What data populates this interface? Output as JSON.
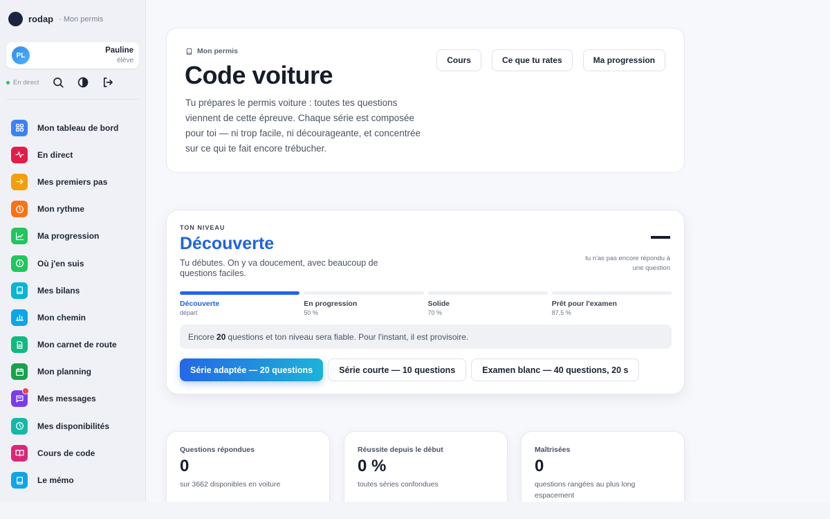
{
  "brand": {
    "name": "rodap",
    "subtitle": "· Mon permis"
  },
  "user": {
    "initials": "PL",
    "name": "Pauline",
    "role": "élève"
  },
  "tools": {
    "live_label": "En direct"
  },
  "nav": [
    {
      "label": "Mon tableau de bord",
      "icon": "dashboard-icon",
      "color": "#3b82f6"
    },
    {
      "label": "En direct",
      "icon": "activity-icon",
      "color": "#e11d48"
    },
    {
      "label": "Mes premiers pas",
      "icon": "arrow-right-icon",
      "color": "#f59e0b"
    },
    {
      "label": "Mon rythme",
      "icon": "clock-icon",
      "color": "#f97316"
    },
    {
      "label": "Ma progression",
      "icon": "chart-icon",
      "color": "#22c55e"
    },
    {
      "label": "Où j'en suis",
      "icon": "info-icon",
      "color": "#22c55e"
    },
    {
      "label": "Mes bilans",
      "icon": "book-icon",
      "color": "#06b6d4"
    },
    {
      "label": "Mon chemin",
      "icon": "bar-chart-icon",
      "color": "#0ea5e9"
    },
    {
      "label": "Mon carnet de route",
      "icon": "document-icon",
      "color": "#10b981"
    },
    {
      "label": "Mon planning",
      "icon": "calendar-icon",
      "color": "#16a34a"
    },
    {
      "label": "Mes messages",
      "icon": "message-icon",
      "color": "#7c3aed",
      "badge": true
    },
    {
      "label": "Mes disponibilités",
      "icon": "clock-icon",
      "color": "#14b8a6"
    },
    {
      "label": "Cours de code",
      "icon": "open-book-icon",
      "color": "#db2777"
    },
    {
      "label": "Le mémo",
      "icon": "book-icon",
      "color": "#0ea5e9"
    }
  ],
  "hero": {
    "eyebrow": "Mon permis",
    "title": "Code voiture",
    "description": "Tu prépares le permis voiture : toutes tes questions viennent de cette épreuve. Chaque série est composée pour toi — ni trop facile, ni décourageante, et concentrée sur ce qui te fait encore trébucher.",
    "actions": [
      "Cours",
      "Ce que tu rates",
      "Ma progression"
    ]
  },
  "level": {
    "eyebrow": "TON NIVEAU",
    "title": "Découverte",
    "description": "Tu débutes. On y va doucement, avec beaucoup de questions faciles.",
    "score_note": "tu n'as pas encore répondu à une question",
    "steps": [
      {
        "name": "Découverte",
        "threshold": "départ",
        "fill": 1.0,
        "active": true
      },
      {
        "name": "En progression",
        "threshold": "50 %",
        "fill": 0
      },
      {
        "name": "Solide",
        "threshold": "70 %",
        "fill": 0
      },
      {
        "name": "Prêt pour l'examen",
        "threshold": "87,5 %",
        "fill": 0
      }
    ],
    "notice": {
      "before": "Encore",
      "count": "20",
      "after": "questions et ton niveau sera fiable. Pour l'instant, il est provisoire."
    },
    "actions": {
      "primary": "Série adaptée — 20 questions",
      "short": "Série courte — 10 questions",
      "exam": "Examen blanc — 40 questions, 20 s"
    }
  },
  "stats": [
    {
      "label": "Questions répondues",
      "value": "0",
      "note": "sur 3662 disponibles en voiture"
    },
    {
      "label": "Réussite depuis le début",
      "value": "0 %",
      "note": "toutes séries confondues"
    },
    {
      "label": "Maîtrisées",
      "value": "0",
      "note": "questions rangées au plus long espacement"
    }
  ]
}
